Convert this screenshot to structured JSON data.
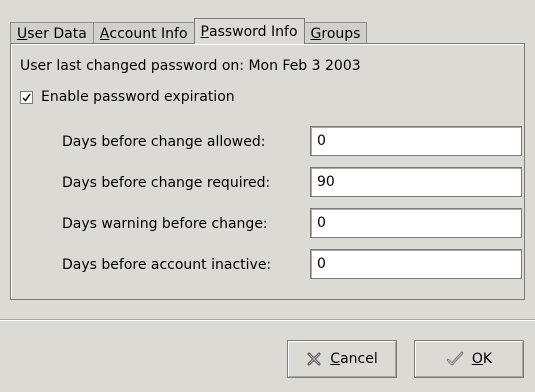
{
  "tabs": [
    {
      "label_mn": "U",
      "label_rest": "ser Data"
    },
    {
      "label_mn": "A",
      "label_rest": "ccount Info"
    },
    {
      "label_mn": "P",
      "label_rest": "assword Info"
    },
    {
      "label_mn": "G",
      "label_rest": "roups"
    }
  ],
  "password": {
    "last_changed_text": "User last changed password on:  Mon Feb  3 2003",
    "enable_expiration_label": "Enable password expiration",
    "enable_expiration_checked": true,
    "fields": [
      {
        "label": "Days before change allowed:",
        "value": "0"
      },
      {
        "label": "Days before change required:",
        "value": "90"
      },
      {
        "label": "Days warning before change:",
        "value": "0"
      },
      {
        "label": "Days before account inactive:",
        "value": "0"
      }
    ]
  },
  "buttons": {
    "cancel_mn": "C",
    "cancel_rest": "ancel",
    "ok_mn": "O",
    "ok_rest": "K"
  }
}
